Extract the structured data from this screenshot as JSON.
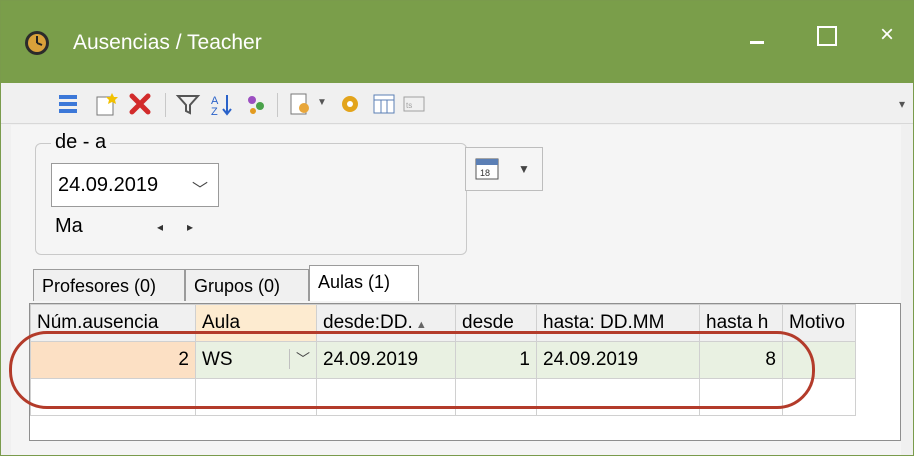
{
  "window": {
    "title": "Ausencias / Teacher"
  },
  "toolbar": {
    "icons": [
      "list-icon",
      "new-icon",
      "delete-icon",
      "filter-icon",
      "sort-icon",
      "users-icon",
      "print-preview-icon",
      "settings-gear-icon",
      "calendar-grid-icon",
      "export-icon"
    ]
  },
  "date_group": {
    "legend": "de - a",
    "date_value": "24.09.2019",
    "weekday": "Ma"
  },
  "tabs": [
    {
      "label": "Profesores (0)"
    },
    {
      "label": "Grupos (0)"
    },
    {
      "label": "Aulas (1)"
    }
  ],
  "grid": {
    "columns": [
      "Núm.ausencia",
      "Aula",
      "desde:DD.",
      "desde",
      "hasta: DD.MM",
      "hasta h",
      "Motivo"
    ],
    "rows": [
      {
        "num": "2",
        "aula": "WS",
        "desde_date": "24.09.2019",
        "desde_h": "1",
        "hasta_date": "24.09.2019",
        "hasta_h": "8",
        "motivo": ""
      }
    ]
  },
  "colors": {
    "titlebar": "#7a9e4a",
    "highlight_oval": "#b33b2a",
    "selected_cell": "#fce0c4"
  }
}
